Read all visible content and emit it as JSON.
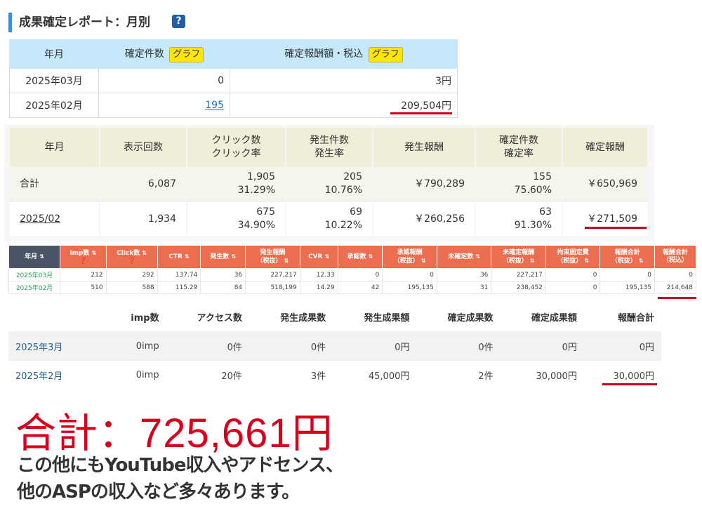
{
  "section1": {
    "title": "成果確定レポート：月別",
    "help_icon": "?",
    "headers": [
      "年月",
      "確定件数",
      "確定報酬額・税込"
    ],
    "graph_label": "グラフ",
    "rows": [
      {
        "ym": "2025年03月",
        "count": "0",
        "amount": "3円"
      },
      {
        "ym": "2025年02月",
        "count": "195",
        "amount": "209,504円"
      }
    ]
  },
  "section2": {
    "headers": [
      "年月",
      "表示回数",
      "クリック数",
      "クリック率",
      "発生件数",
      "発生率",
      "発生報酬",
      "確定件数",
      "確定率",
      "確定報酬"
    ],
    "rows": [
      {
        "ym": "合計",
        "imp": "6,087",
        "clicks": "1,905",
        "ctr": "31.29%",
        "occ": "205",
        "occ_rate": "10.76%",
        "occ_reward": "￥790,289",
        "conf": "155",
        "conf_rate": "75.60%",
        "conf_reward": "￥650,969"
      },
      {
        "ym": "2025/02",
        "imp": "1,934",
        "clicks": "675",
        "ctr": "34.90%",
        "occ": "69",
        "occ_rate": "10.22%",
        "occ_reward": "￥260,256",
        "conf": "63",
        "conf_rate": "91.30%",
        "conf_reward": "￥271,509"
      }
    ]
  },
  "section3": {
    "headers": [
      "年月",
      "Imp数",
      "Click数",
      "CTR",
      "発生数",
      "発生報酬",
      "（税抜）",
      "CVR",
      "承認数",
      "承認報酬",
      "（税抜）",
      "未確定数",
      "未確定報酬",
      "（税抜）",
      "拘束固定費",
      "（税抜）",
      "報酬合計",
      "（税抜）",
      "報酬合計",
      "（税込）"
    ],
    "rows": [
      [
        "2025年03月",
        "212",
        "292",
        "137.74",
        "36",
        "227,217",
        "12.33",
        "0",
        "0",
        "36",
        "227,217",
        "0",
        "0",
        "0"
      ],
      [
        "2025年02月",
        "510",
        "588",
        "115.29",
        "84",
        "518,199",
        "14.29",
        "42",
        "195,135",
        "31",
        "238,452",
        "0",
        "195,135",
        "214,648"
      ]
    ]
  },
  "section4": {
    "headers": [
      "imp数",
      "アクセス数",
      "発生成果数",
      "発生成果額",
      "確定成果数",
      "確定成果額",
      "報酬合計"
    ],
    "rows": [
      [
        "2025年3月",
        "0imp",
        "0件",
        "0件",
        "0円",
        "0件",
        "0円",
        "0円"
      ],
      [
        "2025年2月",
        "0imp",
        "20件",
        "3件",
        "45,000円",
        "2件",
        "30,000円",
        "30,000円"
      ]
    ]
  },
  "summary": {
    "total": "合計：725,661円",
    "note_line1": "この他にもYouTube収入やアドセンス、",
    "note_line2": "他のASPの収入など多々あります。"
  },
  "colors": {
    "accent_red": "#d6001c",
    "header_orange": "#ec6d4f",
    "header_blue": "#c5e8fb",
    "graph_yellow": "#ffe600"
  }
}
